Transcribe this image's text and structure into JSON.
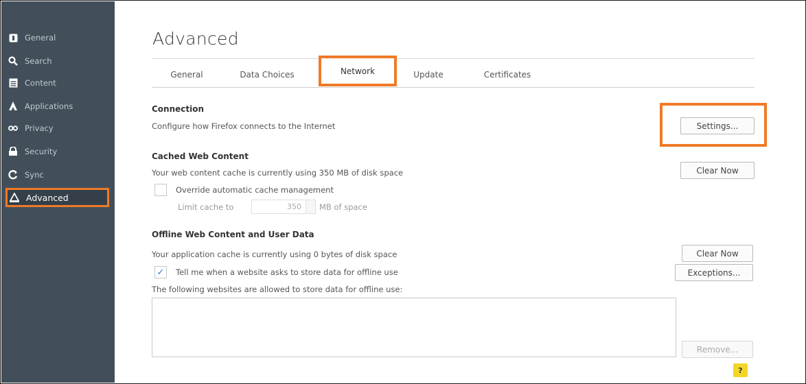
{
  "accent_color": "#f07a27",
  "sidebar": {
    "items": [
      {
        "label": "General",
        "icon": "general-icon"
      },
      {
        "label": "Search",
        "icon": "search-icon"
      },
      {
        "label": "Content",
        "icon": "content-icon"
      },
      {
        "label": "Applications",
        "icon": "applications-icon"
      },
      {
        "label": "Privacy",
        "icon": "privacy-mask-icon"
      },
      {
        "label": "Security",
        "icon": "lock-icon"
      },
      {
        "label": "Sync",
        "icon": "sync-icon"
      },
      {
        "label": "Advanced",
        "icon": "advanced-icon",
        "selected": true
      }
    ]
  },
  "page": {
    "title": "Advanced"
  },
  "tabs": [
    {
      "label": "General"
    },
    {
      "label": "Data Choices"
    },
    {
      "label": "Network",
      "active": true
    },
    {
      "label": "Update"
    },
    {
      "label": "Certificates"
    }
  ],
  "connection": {
    "heading": "Connection",
    "description": "Configure how Firefox connects to the Internet",
    "settings_button": "Settings..."
  },
  "cache": {
    "heading": "Cached Web Content",
    "description": "Your web content cache is currently using 350 MB of disk space",
    "clear_button": "Clear Now",
    "override_label": "Override automatic cache management",
    "override_checked": false,
    "limit_label": "Limit cache to",
    "limit_value": "350",
    "limit_unit": "MB of space"
  },
  "offline": {
    "heading": "Offline Web Content and User Data",
    "description": "Your application cache is currently using 0 bytes of disk space",
    "clear_button": "Clear Now",
    "tell_me_label": "Tell me when a website asks to store data for offline use",
    "tell_me_checked": true,
    "exceptions_button": "Exceptions...",
    "allowed_label": "The following websites are allowed to store data for offline use:",
    "remove_button": "Remove..."
  },
  "help_button": "?"
}
